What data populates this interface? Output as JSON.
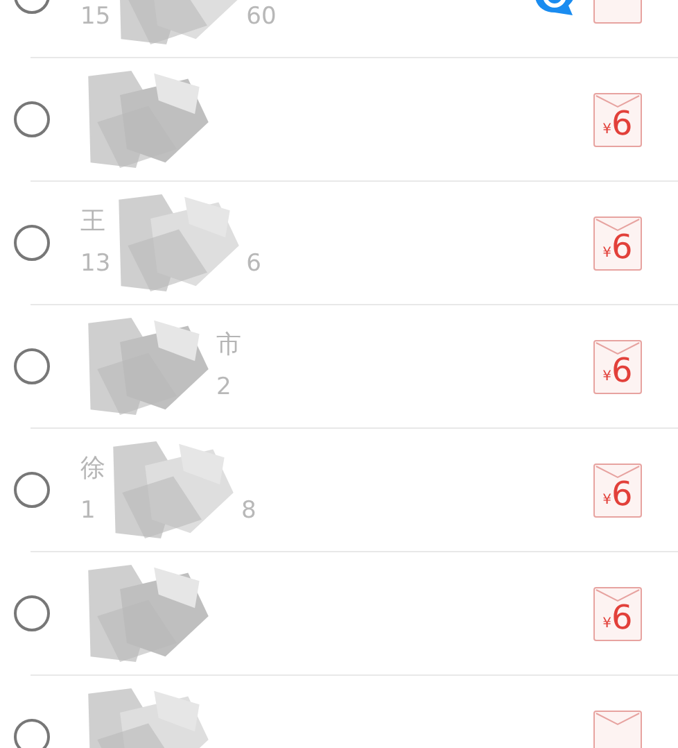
{
  "contacts": [
    {
      "checked": false,
      "phone_start": "15",
      "phone_end": "60",
      "chat_badge": true
    },
    {
      "checked": false,
      "chat_badge": false,
      "red_packet": {
        "currency": "¥",
        "amount": "6"
      }
    },
    {
      "checked": false,
      "name_start": "王",
      "phone_start": "13",
      "phone_end": "6",
      "chat_badge": false,
      "red_packet": {
        "currency": "¥",
        "amount": "6"
      }
    },
    {
      "checked": false,
      "name_end": "市",
      "phone_end": "2",
      "chat_badge": false,
      "red_packet": {
        "currency": "¥",
        "amount": "6"
      }
    },
    {
      "checked": false,
      "name_start": "徐",
      "phone_start": "1",
      "phone_end": "8",
      "chat_badge": false,
      "red_packet": {
        "currency": "¥",
        "amount": "6"
      }
    },
    {
      "checked": false,
      "chat_badge": false,
      "red_packet": {
        "currency": "¥",
        "amount": "6"
      }
    },
    {
      "checked": false,
      "chat_badge": false
    }
  ]
}
